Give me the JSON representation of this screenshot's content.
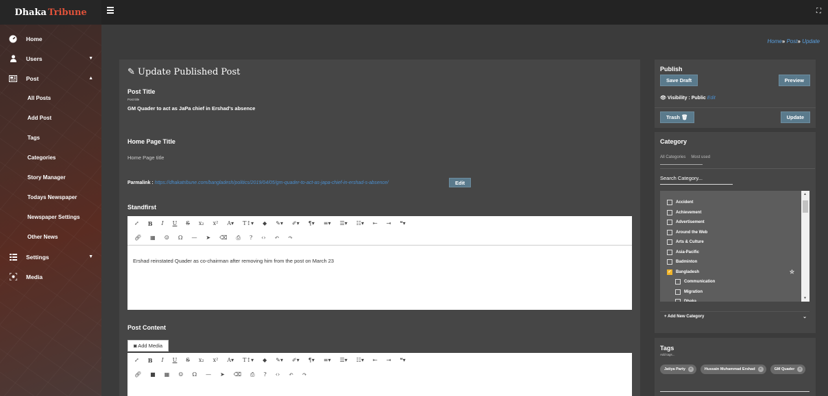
{
  "brand": {
    "part1": "Dhaka",
    "part2": "Tribune"
  },
  "sidebar": {
    "items": [
      {
        "label": "Home",
        "icon": "dashboard-icon"
      },
      {
        "label": "Users",
        "icon": "user-icon"
      },
      {
        "label": "Post",
        "icon": "post-icon"
      },
      {
        "label": "All Posts"
      },
      {
        "label": "Add Post"
      },
      {
        "label": "Tags"
      },
      {
        "label": "Categories"
      },
      {
        "label": "Story Manager"
      },
      {
        "label": "Todays Newspaper"
      },
      {
        "label": "Newspaper Settings"
      },
      {
        "label": "Other News"
      },
      {
        "label": "Settings",
        "icon": "settings-icon"
      },
      {
        "label": "Media",
        "icon": "media-icon"
      }
    ]
  },
  "breadcrumb": {
    "home": "Home",
    "sep": "»",
    "post": "Post",
    "current": "Update"
  },
  "page": {
    "title": "Update Published Post"
  },
  "form": {
    "post_title_label": "Post Title",
    "post_title_small": "Post title",
    "post_title_value": "GM Quader to act as JaPa chief in Ershad's absence",
    "home_title_label": "Home Page Title",
    "home_title_placeholder": "Home Page title",
    "permalink_label": "Parmalink :",
    "permalink_url": "https://dhakatribune.com/bangladesh/politics/2019/04/05/gm-quader-to-act-as-japa-chief-in-ershad-s-absence/",
    "edit_label": "Edit",
    "standfirst_label": "Standfirst",
    "standfirst_text": "Ershad reinstated Quader as co-chairman after removing him from the post on March 23",
    "post_content_label": "Post Content",
    "add_media_label": "Add Media"
  },
  "publish": {
    "title": "Publish",
    "save_draft": "Save Draft",
    "preview": "Preview",
    "visibility": "Visibility : Public",
    "visibility_edit": "Edit",
    "trash": "Trash",
    "update": "Update"
  },
  "category": {
    "title": "Category",
    "tab_all": "All Categories",
    "tab_most": "Most used",
    "search_placeholder": "Search Category...",
    "items": [
      {
        "label": "Accident",
        "checked": false,
        "child": false
      },
      {
        "label": "Achievement",
        "checked": false,
        "child": false
      },
      {
        "label": "Advertisement",
        "checked": false,
        "child": false
      },
      {
        "label": "Around the Web",
        "checked": false,
        "child": false
      },
      {
        "label": "Arts & Culture",
        "checked": false,
        "child": false
      },
      {
        "label": "Asia-Pacific",
        "checked": false,
        "child": false
      },
      {
        "label": "Badminton",
        "checked": false,
        "child": false
      },
      {
        "label": "Bangladesh",
        "checked": true,
        "child": false
      },
      {
        "label": "Communication",
        "checked": false,
        "child": true
      },
      {
        "label": "Migration",
        "checked": false,
        "child": true
      },
      {
        "label": "Dhaka",
        "checked": false,
        "child": true
      }
    ],
    "add_new": "+ Add New Category"
  },
  "tags": {
    "title": "Tags",
    "placeholder": "Add tags...",
    "items": [
      "Jatiya Party",
      "Hussain Muhammad Ershad",
      "GM Quader"
    ]
  }
}
